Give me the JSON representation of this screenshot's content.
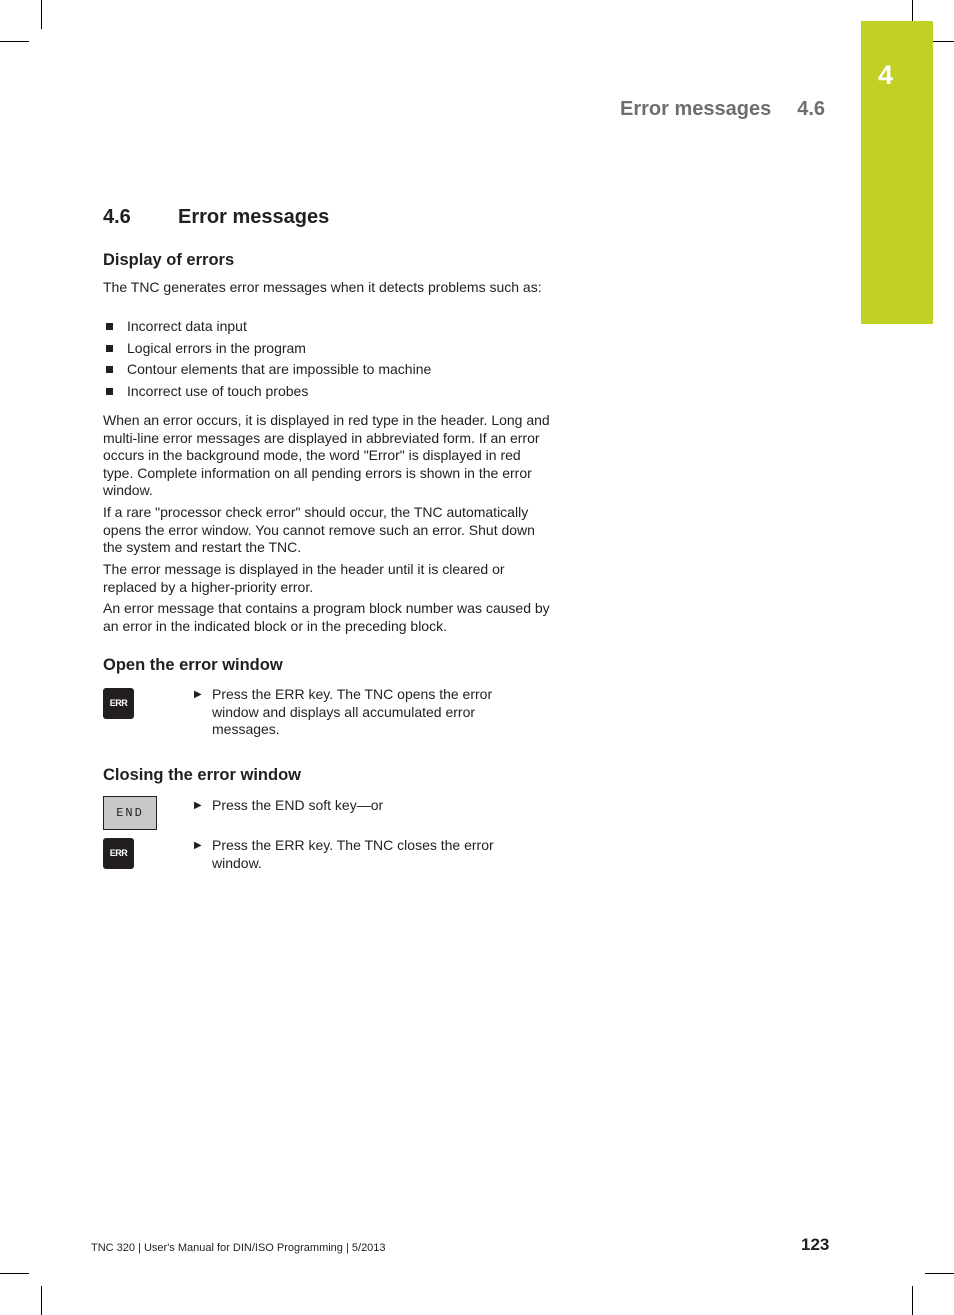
{
  "chapter_tab": {
    "number": "4",
    "color": "#c2cf25"
  },
  "running_header": {
    "title": "Error messages",
    "section": "4.6"
  },
  "section": {
    "number": "4.6",
    "title": "Error messages"
  },
  "display_of_errors": {
    "heading": "Display of errors",
    "intro": "The TNC generates error messages when it detects problems such as:",
    "bullets": [
      "Incorrect data input",
      "Logical errors in the program",
      "Contour elements that are impossible to machine",
      "Incorrect use of touch probes"
    ],
    "paragraphs": [
      "When an error occurs, it is displayed in red type in the header. Long and multi-line error messages are displayed in abbreviated form. If an error occurs in the background mode, the word \"Error\" is displayed in red type. Complete information on all pending errors is shown in the error window.",
      "If a rare \"processor check error\" should occur, the TNC automatically opens the error window. You cannot remove such an error. Shut down the system and restart the TNC.",
      "The error message is displayed in the header until it is cleared or replaced by a higher-priority error.",
      "An error message that contains a program block number was caused by an error in the indicated block or in the preceding block."
    ]
  },
  "open_window": {
    "heading": "Open the error window",
    "key_label": "ERR",
    "step": "Press the ERR key. The TNC opens the error window and displays all accumulated error messages."
  },
  "close_window": {
    "heading": "Closing the error window",
    "softkey_label": "END",
    "step1": "Press the END soft key—or",
    "key_label": "ERR",
    "step2": "Press the ERR key. The TNC closes the error window."
  },
  "footer": {
    "text": "TNC 320 | User's Manual for DIN/ISO Programming | 5/2013",
    "page_number": "123"
  },
  "icons": {
    "bullet": "square-bullet-icon",
    "step": "triangle-right-icon"
  }
}
